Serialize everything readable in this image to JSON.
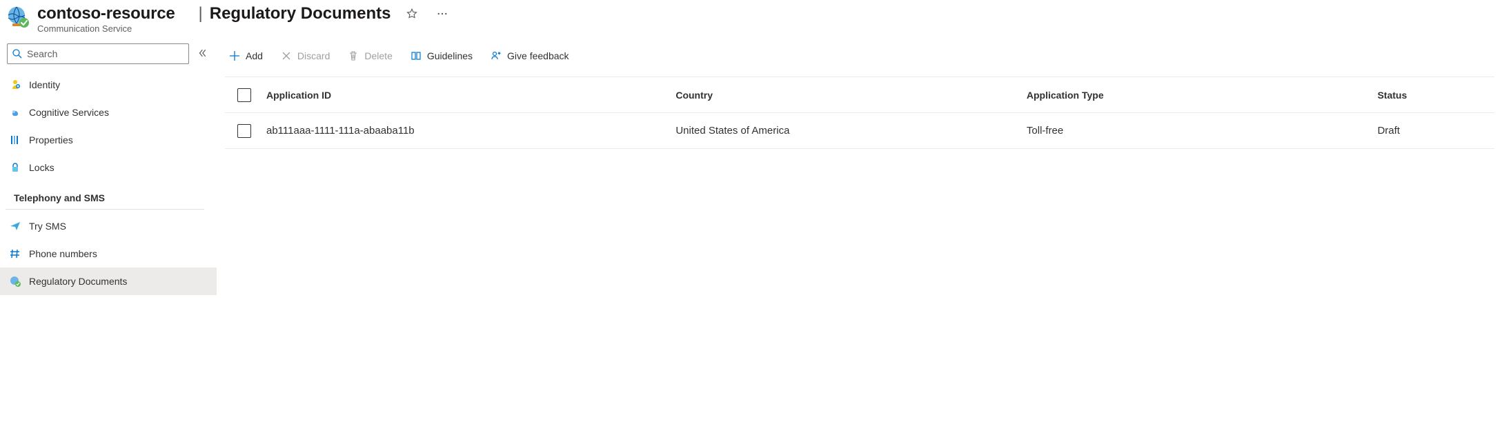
{
  "header": {
    "resource_name": "contoso-resource",
    "page_title": "Regulatory Documents",
    "subtitle": "Communication Service"
  },
  "search": {
    "placeholder": "Search"
  },
  "nav": {
    "top_items": [
      {
        "id": "identity",
        "label": "Identity",
        "icon": "identity"
      },
      {
        "id": "cognitive",
        "label": "Cognitive Services",
        "icon": "cognitive"
      },
      {
        "id": "properties",
        "label": "Properties",
        "icon": "properties"
      },
      {
        "id": "locks",
        "label": "Locks",
        "icon": "lock"
      }
    ],
    "section_heading": "Telephony and SMS",
    "telephony_items": [
      {
        "id": "trysms",
        "label": "Try SMS",
        "icon": "plane"
      },
      {
        "id": "phone",
        "label": "Phone numbers",
        "icon": "hash"
      },
      {
        "id": "regdocs",
        "label": "Regulatory Documents",
        "icon": "regdoc",
        "selected": true
      }
    ]
  },
  "toolbar": {
    "add": "Add",
    "discard": "Discard",
    "delete": "Delete",
    "guidelines": "Guidelines",
    "feedback": "Give feedback"
  },
  "table": {
    "headers": {
      "app_id": "Application ID",
      "country": "Country",
      "app_type": "Application Type",
      "status": "Status"
    },
    "rows": [
      {
        "app_id": "ab111aaa-1111-111a-abaaba11b",
        "country": "United States of America",
        "app_type": "Toll-free",
        "status": "Draft"
      }
    ]
  }
}
